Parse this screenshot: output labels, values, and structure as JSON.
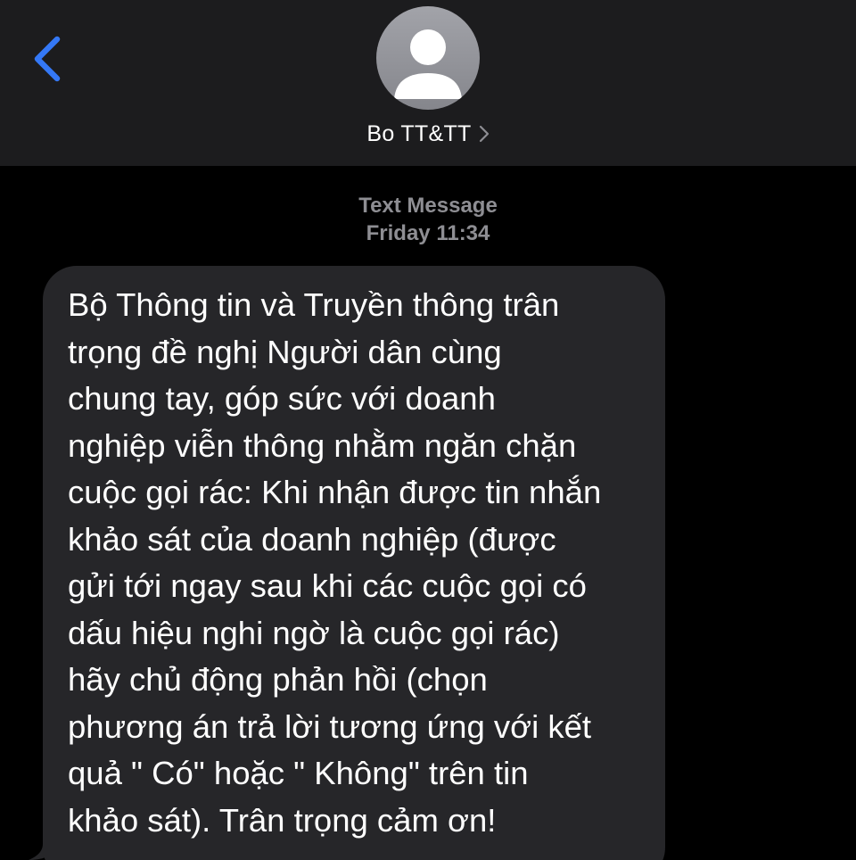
{
  "header": {
    "back_icon": "chevron-left-icon",
    "avatar_icon": "person-silhouette-icon",
    "contact_name": "Bo TT&TT",
    "contact_chevron_icon": "chevron-right-icon"
  },
  "thread": {
    "service_label": "Text Message",
    "timestamp": "Friday 11:34",
    "messages": [
      {
        "direction": "incoming",
        "text": "Bộ Thông tin và Truyền thông trân\ntrọng đề nghị Người dân cùng\nchung tay, góp sức với doanh\nnghiệp viễn thông nhằm ngăn chặn\ncuộc gọi rác: Khi nhận được tin nhắn\nkhảo sát của doanh nghiệp (được\ngửi tới ngay sau khi các cuộc gọi có\ndấu hiệu nghi ngờ là cuộc gọi rác)\nhãy chủ động phản hồi (chọn\nphương án trả lời tương ứng với kết\nquả \" Có\" hoặc \" Không\" trên tin\nkhảo sát). Trân trọng cảm ơn!"
      }
    ]
  },
  "colors": {
    "background": "#000000",
    "header_background": "#1c1c1e",
    "accent_blue": "#3478f6",
    "incoming_bubble": "#262629",
    "secondary_text": "#8e8e93",
    "primary_text": "#ffffff"
  }
}
